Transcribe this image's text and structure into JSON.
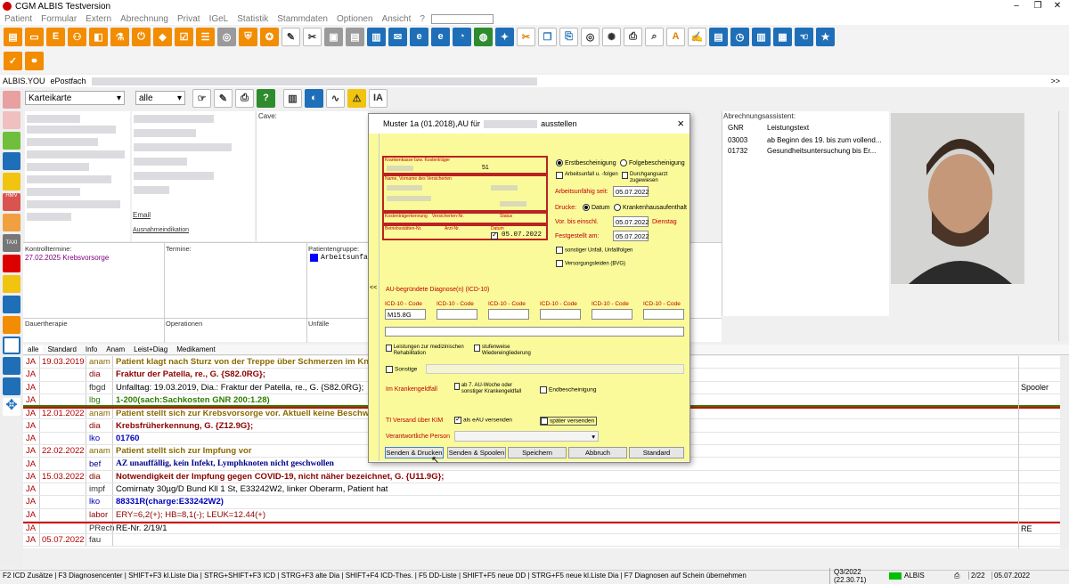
{
  "window": {
    "title": "CGM ALBIS Testversion"
  },
  "menu": [
    "Patient",
    "Formular",
    "Extern",
    "Abrechnung",
    "Privat",
    "IGeL",
    "Statistik",
    "Stammdaten",
    "Optionen",
    "Ansicht",
    "?"
  ],
  "tabs": [
    "ALBIS.YOU",
    "ePostfach"
  ],
  "karteikarte": {
    "view_label": "Karteikarte",
    "filter_label": "alle"
  },
  "header_labels": {
    "email": "Email",
    "ausnahme": "Ausnahmeindikation",
    "cave": "Cave:",
    "abrechnung": "Abrechnungsassistent:"
  },
  "abrechnung": {
    "col_gnr": "GNR",
    "col_text": "Leistungstext",
    "rows": [
      {
        "gnr": "03003",
        "text": "ab Beginn des 19. bis zum vollend..."
      },
      {
        "gnr": "01732",
        "text": "Gesundheitsuntersuchung bis Er..."
      }
    ]
  },
  "lower_panels": {
    "kontrolltermine": "Kontrolltermine:",
    "kontroll_value": "27.02.2025 Krebsvorsorge",
    "termine": "Termine:",
    "patientengruppe": "Patientengruppe:",
    "patientengruppe_value": "Arbeitsunfa",
    "dauertherapie": "Dauertherapie",
    "operationen": "Operationen",
    "unfaelle": "Unfälle"
  },
  "grid_tabs": [
    "alle",
    "Standard",
    "Info",
    "Anam",
    "Leist+Diag",
    "Medikament"
  ],
  "grid_rows": [
    {
      "a": "JA",
      "date": "19.03.2019",
      "type": "anam",
      "text": "Patient klagt nach Sturz von der Treppe über Schmerzen im Kniebereich",
      "color": "#8a6a00",
      "bold": true
    },
    {
      "a": "JA",
      "date": "",
      "type": "dia",
      "text": "Fraktur der Patella, re., G. {S82.0RG};",
      "color": "#8b0000",
      "bold": true
    },
    {
      "a": "JA",
      "date": "",
      "type": "fbgd",
      "text": "Unfalltag: 19.03.2019, Dia.: Fraktur der Patella, re., G. {S82.0RG};",
      "color": "#000",
      "bold": false,
      "right": "Spooler"
    },
    {
      "a": "JA",
      "date": "",
      "type": "lbg",
      "text": "1-200(sach:Sachkosten GNR 200:1.28)",
      "color": "#2e7d00",
      "bold": true
    },
    {
      "a": "JA",
      "date": "12.01.2022",
      "type": "anam",
      "text": "Patient stellt sich zur Krebsvorsorge vor. Aktuell keine Beschweden.",
      "color": "#8a6a00",
      "bold": true
    },
    {
      "a": "JA",
      "date": "",
      "type": "dia",
      "text": "Krebsfrüherkennung, G. {Z12.9G};",
      "color": "#8b0000",
      "bold": true
    },
    {
      "a": "JA",
      "date": "",
      "type": "lko",
      "text": "01760",
      "color": "#0000c0",
      "bold": true
    },
    {
      "a": "JA",
      "date": "22.02.2022",
      "type": "anam",
      "text": "Patient stellt sich zur Impfung vor",
      "color": "#8a6a00",
      "bold": true
    },
    {
      "a": "JA",
      "date": "",
      "type": "bef",
      "text": "AZ unauffällig, kein Infekt, Lymphknoten nicht geschwollen",
      "color": "#00008b",
      "bold": true
    },
    {
      "a": "JA",
      "date": "15.03.2022",
      "type": "dia",
      "text": "Notwendigkeit der Impfung gegen COVID-19, nicht näher bezeichnet, G. {U11.9G};",
      "color": "#8b0000",
      "bold": true
    },
    {
      "a": "JA",
      "date": "",
      "type": "impf",
      "text": "Comirnaty 30µg/D Bund Kll 1 St, E33242W2, linker Oberarm, Patient hat",
      "color": "#000",
      "bold": false
    },
    {
      "a": "JA",
      "date": "",
      "type": "lko",
      "text": "88331R(charge:E33242W2)",
      "color": "#0000c0",
      "bold": true
    },
    {
      "a": "JA",
      "date": "",
      "type": "labor",
      "text": "ERY=6,2(+); HB=8,1(-); LEUK=12.44(+)",
      "color": "#8b0000",
      "bold": false
    },
    {
      "a": "JA",
      "date": "",
      "type": "PRech",
      "text": "RE-Nr. 2/19/1",
      "color": "#000",
      "bold": false,
      "right": "RE"
    },
    {
      "a": "JA",
      "date": "05.07.2022",
      "type": "fau",
      "text": "",
      "color": "#000",
      "bold": false
    }
  ],
  "status": {
    "hotkeys": "F2 ICD Zusätze | F3 Diagnosencenter | SHIFT+F3 kl.Liste Dia | STRG+SHIFT+F3 ICD | STRG+F3 alte Dia | SHIFT+F4 ICD-Thes. | F5 DD-Liste | SHIFT+F5 neue DD | STRG+F5 neue kl.Liste Dia | F7 Diagnosen auf Schein übernehmen",
    "quarter": "Q3/2022 (22.30.71)",
    "app": "ALBIS",
    "page": "2/22",
    "date": "05.07.2022"
  },
  "dialog": {
    "title_prefix": "Muster 1a (01.2018),AU für",
    "title_suffix": "ausstellen",
    "close": "×",
    "krankenkasse_label": "Krankenkasse bzw. Kostenträger",
    "kk_value": "51",
    "name_label": "Name, Vorname des Versicherten",
    "kostentraeger_label": "Kostenträgerkennung",
    "versichertennr_label": "Versicherten-Nr.",
    "status_label": "Status",
    "betriebsstaette_label": "Betriebsstätten-Nr.",
    "arzt_label": "Arzt-Nr.",
    "datum_label": "Datum",
    "datum_value": "05.07.2022",
    "erst": "Erstbescheinigung",
    "folge": "Folgebescheinigung",
    "arbeitsunfall": "Arbeitsunfall u. -folgen",
    "durchgangsarzt": "Durchgangsarzt zugewiesen",
    "au_seit_label": "Arbeitsunfähig seit:",
    "au_seit": "05.07.2022",
    "drucke": "Drucke:",
    "datum_opt": "Datum",
    "kh_opt": "Krankenhausaufenthalt",
    "bis_label": "Vor. bis einschl.",
    "bis_value": "05.07.2022",
    "weekday": "Dienstag",
    "festgestellt_label": "Festgestellt am:",
    "festgestellt": "05.07.2022",
    "sonstiger_unfall": "sonstiger Unfall, Unfallfolgen",
    "versorgungsleiden": "Versorgungsleiden (BVG)",
    "diag_title": "AU-begründete Diagnose(n) (ICD-10)",
    "icd_label": "ICD-10 - Code",
    "icd_values": [
      "M15.8G",
      "",
      "",
      "",
      "",
      ""
    ],
    "reha": "Leistungen zur medizinischen Rehabilitation",
    "stufenweise": "stufenweise Wiedereingliederung",
    "sonstige": "Sonstige",
    "krankengeld_label": "Im Krankengeldfall",
    "ab7": "ab 7. AU-Woche oder sonstiger Krankengeldfall",
    "endbescheinigung": "Endbescheinigung",
    "ti_label": "TI Versand über KIM",
    "eau": "als eAU versenden",
    "spaeter": "später versenden",
    "verantwortlich": "Verantwortliche Person",
    "buttons": [
      "Senden & Drucken",
      "Senden & Spoolen",
      "Speichern",
      "Abbruch",
      "Standard"
    ],
    "collapse": "<<"
  }
}
